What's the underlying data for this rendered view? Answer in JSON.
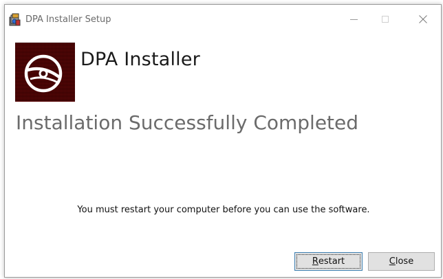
{
  "window": {
    "title": "DPA Installer Setup"
  },
  "header": {
    "product_name": "DPA Installer"
  },
  "main": {
    "status_heading": "Installation Successfully Completed",
    "message": "You must restart your computer before you can use the software."
  },
  "buttons": {
    "restart": {
      "label": "Restart",
      "mnemonic": "R",
      "rest": "estart"
    },
    "close": {
      "label": "Close",
      "mnemonic": "C",
      "rest": "lose"
    }
  },
  "icons": {
    "app": "installer-icon",
    "logo": "disc-logo-icon",
    "minimize": "minimize-icon",
    "maximize": "maximize-icon",
    "close": "close-icon"
  },
  "colors": {
    "logo_background": "#3a0000",
    "heading_text": "#6b6b6b",
    "button_face": "#e1e1e1",
    "focus_border": "#3c7fb1"
  }
}
